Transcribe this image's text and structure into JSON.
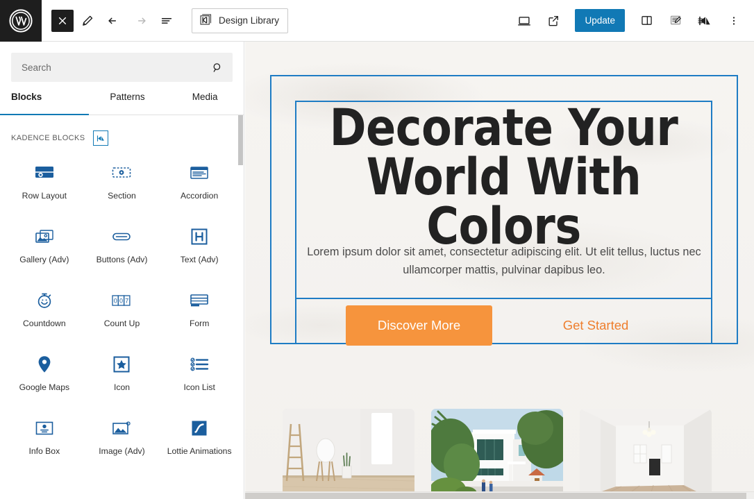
{
  "toolbar": {
    "wp_logo": "wordpress-logo",
    "close_label": "×",
    "icons": {
      "close": "close-icon",
      "edit": "pencil-edit-icon",
      "undo": "undo-arrow-icon",
      "redo": "redo-arrow-icon",
      "list_view": "list-view-icon",
      "design_library": "kadence-design-library-icon",
      "desktop_preview": "desktop-preview-icon",
      "view_site": "external-link-icon",
      "settings_sidebar": "sidebar-panel-icon",
      "draft_notes": "draft-notes-icon",
      "kadence": "kadence-k-icon",
      "options": "three-dot-vertical-icon"
    },
    "design_library_label": "Design Library",
    "update_label": "Update",
    "accent_blue": "#1179b5"
  },
  "sidebar": {
    "search": {
      "placeholder": "Search",
      "value": "",
      "icon": "search-icon"
    },
    "tabs": [
      {
        "label": "Blocks",
        "active": true
      },
      {
        "label": "Patterns",
        "active": false
      },
      {
        "label": "Media",
        "active": false
      }
    ],
    "section_title": "KADENCE BLOCKS",
    "section_badge_icon": "kadence-k-icon",
    "blocks": [
      {
        "label": "Row Layout",
        "icon": "row-layout-icon"
      },
      {
        "label": "Section",
        "icon": "section-icon"
      },
      {
        "label": "Accordion",
        "icon": "accordion-icon"
      },
      {
        "label": "Gallery (Adv)",
        "icon": "gallery-icon"
      },
      {
        "label": "Buttons (Adv)",
        "icon": "buttons-icon"
      },
      {
        "label": "Text (Adv)",
        "icon": "text-heading-icon"
      },
      {
        "label": "Countdown",
        "icon": "countdown-timer-icon"
      },
      {
        "label": "Count Up",
        "icon": "count-up-icon"
      },
      {
        "label": "Form",
        "icon": "form-icon"
      },
      {
        "label": "Google Maps",
        "icon": "map-pin-icon"
      },
      {
        "label": "Icon",
        "icon": "star-icon"
      },
      {
        "label": "Icon List",
        "icon": "icon-list-icon"
      },
      {
        "label": "Info Box",
        "icon": "info-box-icon"
      },
      {
        "label": "Image (Adv)",
        "icon": "image-icon"
      },
      {
        "label": "Lottie Animations",
        "icon": "lottie-animation-icon"
      }
    ],
    "block_icon_color": "#1b5e9e"
  },
  "canvas": {
    "hero": {
      "title": "Decorate Your World With Colors",
      "paragraph": "Lorem ipsum dolor sit amet, consectetur adipiscing elit. Ut elit tellus, luctus nec ullamcorper mattis, pulvinar dapibus leo.",
      "primary_button": "Discover More",
      "secondary_button": "Get Started",
      "primary_button_color": "#f6943d",
      "secondary_button_color": "#ee7e2d",
      "selection_border_color": "#1e7cc4",
      "background_color": "#f4f2ef"
    },
    "cards": [
      {
        "alt": "empty white room with wooden ladder, stool and plant"
      },
      {
        "alt": "modern white two-story house behind green trees"
      },
      {
        "alt": "bright empty hallway with chandelier and wood floor"
      }
    ]
  }
}
